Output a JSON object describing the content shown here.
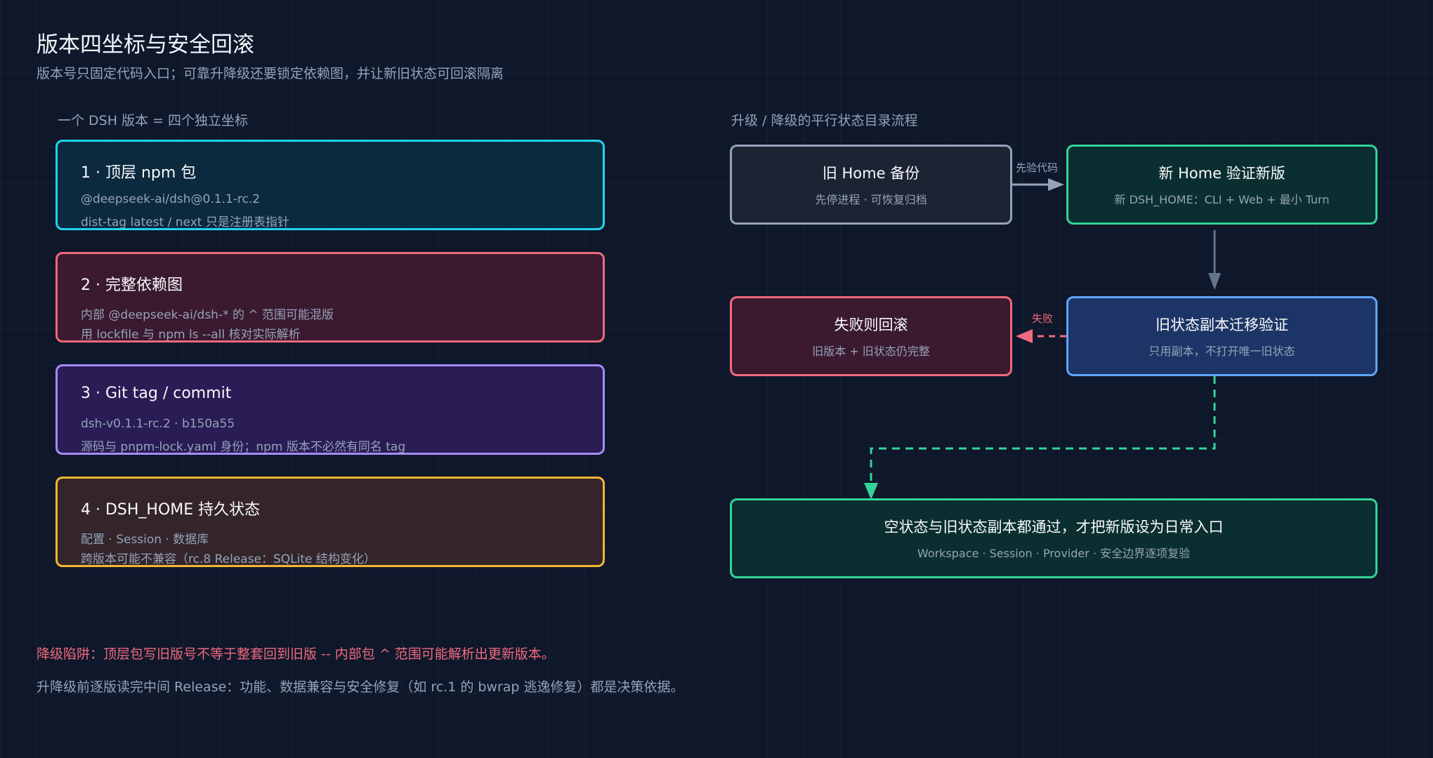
{
  "header": {
    "title": "版本四坐标与安全回滚",
    "subtitle": "版本号只固定代码入口；可靠升降级还要锁定依赖图，并让新旧状态可回滚隔离"
  },
  "left_panel": {
    "label": "一个 DSH 版本 = 四个独立坐标",
    "cards": [
      {
        "title": "1 · 顶层 npm 包",
        "line1": "@deepseek-ai/dsh@0.1.1-rc.2",
        "line2": "dist-tag latest / next 只是注册表指针"
      },
      {
        "title": "2 · 完整依赖图",
        "line1": "内部 @deepseek-ai/dsh-* 的 ^ 范围可能混版",
        "line2": "用 lockfile 与 npm ls --all 核对实际解析"
      },
      {
        "title": "3 · Git tag / commit",
        "line1": "dsh-v0.1.1-rc.2 · b150a55",
        "line2": "源码与 pnpm-lock.yaml 身份；npm 版本不必然有同名 tag"
      },
      {
        "title": "4 · DSH_HOME 持久状态",
        "line1": "配置 · Session · 数据库",
        "line2": "跨版本可能不兼容（rc.8 Release：SQLite 结构变化）"
      }
    ]
  },
  "right_panel": {
    "label": "升级 / 降级的平行状态目录流程",
    "nodes": {
      "backup": {
        "title": "旧 Home 备份",
        "sub": "先停进程 · 可恢复归档"
      },
      "verify_new": {
        "title": "新 Home 验证新版",
        "sub": "新 DSH_HOME：CLI + Web + 最小 Turn"
      },
      "rollback": {
        "title": "失败则回滚",
        "sub": "旧版本 + 旧状态仍完整"
      },
      "migrate": {
        "title": "旧状态副本迁移验证",
        "sub": "只用副本，不打开唯一旧状态"
      },
      "final": {
        "title": "空状态与旧状态副本都通过，才把新版设为日常入口",
        "sub": "Workspace · Session · Provider · 安全边界逐项复验"
      }
    },
    "edges": {
      "code_first": "先验代码",
      "failure": "失败"
    }
  },
  "footer": {
    "warning": "降级陷阱：顶层包写旧版号不等于整套回到旧版 -- 内部包 ^ 范围可能解析出更新版本。",
    "note": "升降级前逐版读完中间 Release：功能、数据兼容与安全修复（如 rc.1 的 bwrap 逃逸修复）都是决策依据。"
  },
  "colors": {
    "background": "#0f172a",
    "cyan": "#22d3ee",
    "rose": "#f06a7e",
    "violet": "#a78bfa",
    "amber": "#f5b731",
    "green": "#34d399",
    "blue": "#60a5fa",
    "slate": "#94a3b8"
  }
}
